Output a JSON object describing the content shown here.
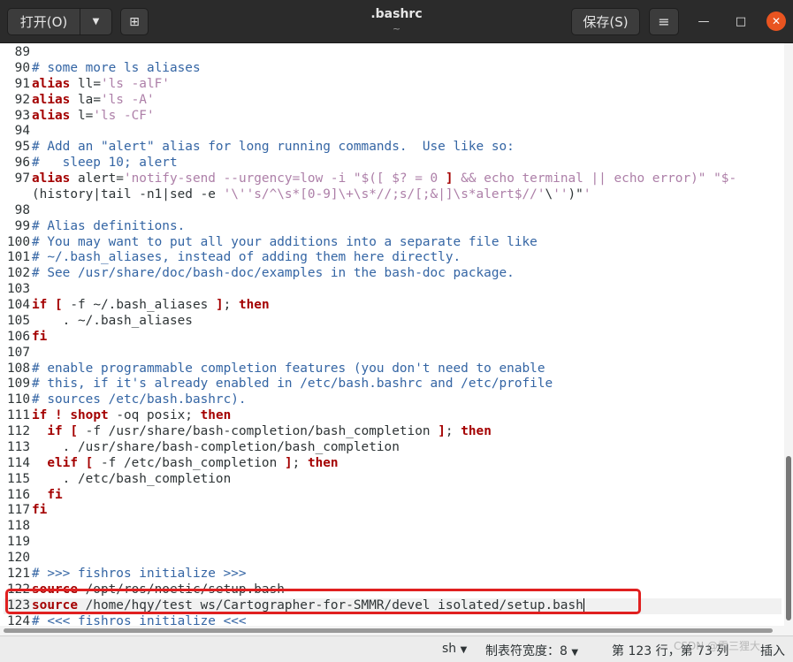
{
  "toolbar": {
    "open_label": "打开(O)",
    "save_label": "保存(S)",
    "title": ".bashrc",
    "subtitle": "~"
  },
  "editor": {
    "lines": [
      {
        "n": "89",
        "t": ""
      },
      {
        "n": "90",
        "t": "# some more ls aliases"
      },
      {
        "n": "91",
        "t": "alias ll='ls -alF'"
      },
      {
        "n": "92",
        "t": "alias la='ls -A'"
      },
      {
        "n": "93",
        "t": "alias l='ls -CF'"
      },
      {
        "n": "94",
        "t": ""
      },
      {
        "n": "95",
        "t": "# Add an \"alert\" alias for long running commands.  Use like so:"
      },
      {
        "n": "96",
        "t": "#   sleep 10; alert"
      },
      {
        "n": "97",
        "t": "alias alert='notify-send --urgency=low -i \"$([ $? = 0 ] && echo terminal || echo error)\" \"$-"
      },
      {
        "n": "",
        "t": "(history|tail -n1|sed -e '\\''s/^\\s*[0-9]\\+\\s*//;s/[;&|]\\s*alert$//'\\'')\"'"
      },
      {
        "n": "98",
        "t": ""
      },
      {
        "n": "99",
        "t": "# Alias definitions."
      },
      {
        "n": "100",
        "t": "# You may want to put all your additions into a separate file like"
      },
      {
        "n": "101",
        "t": "# ~/.bash_aliases, instead of adding them here directly."
      },
      {
        "n": "102",
        "t": "# See /usr/share/doc/bash-doc/examples in the bash-doc package."
      },
      {
        "n": "103",
        "t": ""
      },
      {
        "n": "104",
        "t": "if [ -f ~/.bash_aliases ]; then"
      },
      {
        "n": "105",
        "t": "    . ~/.bash_aliases"
      },
      {
        "n": "106",
        "t": "fi"
      },
      {
        "n": "107",
        "t": ""
      },
      {
        "n": "108",
        "t": "# enable programmable completion features (you don't need to enable"
      },
      {
        "n": "109",
        "t": "# this, if it's already enabled in /etc/bash.bashrc and /etc/profile"
      },
      {
        "n": "110",
        "t": "# sources /etc/bash.bashrc)."
      },
      {
        "n": "111",
        "t": "if ! shopt -oq posix; then"
      },
      {
        "n": "112",
        "t": "  if [ -f /usr/share/bash-completion/bash_completion ]; then"
      },
      {
        "n": "113",
        "t": "    . /usr/share/bash-completion/bash_completion"
      },
      {
        "n": "114",
        "t": "  elif [ -f /etc/bash_completion ]; then"
      },
      {
        "n": "115",
        "t": "    . /etc/bash_completion"
      },
      {
        "n": "116",
        "t": "  fi"
      },
      {
        "n": "117",
        "t": "fi"
      },
      {
        "n": "118",
        "t": ""
      },
      {
        "n": "119",
        "t": ""
      },
      {
        "n": "120",
        "t": ""
      },
      {
        "n": "121",
        "t": "# >>> fishros initialize >>>"
      },
      {
        "n": "122",
        "t": "source /opt/ros/noetic/setup.bash"
      },
      {
        "n": "123",
        "t": "source /home/hqy/test_ws/Cartographer-for-SMMR/devel_isolated/setup.bash"
      },
      {
        "n": "124",
        "t": "# <<< fishros initialize <<<"
      }
    ],
    "current_line": "123"
  },
  "status": {
    "language": "sh",
    "tab_width": "制表符宽度：8",
    "position": "第 123 行，第 73 列",
    "mode": "插入"
  },
  "watermark": "CSDN @雪三狸大"
}
